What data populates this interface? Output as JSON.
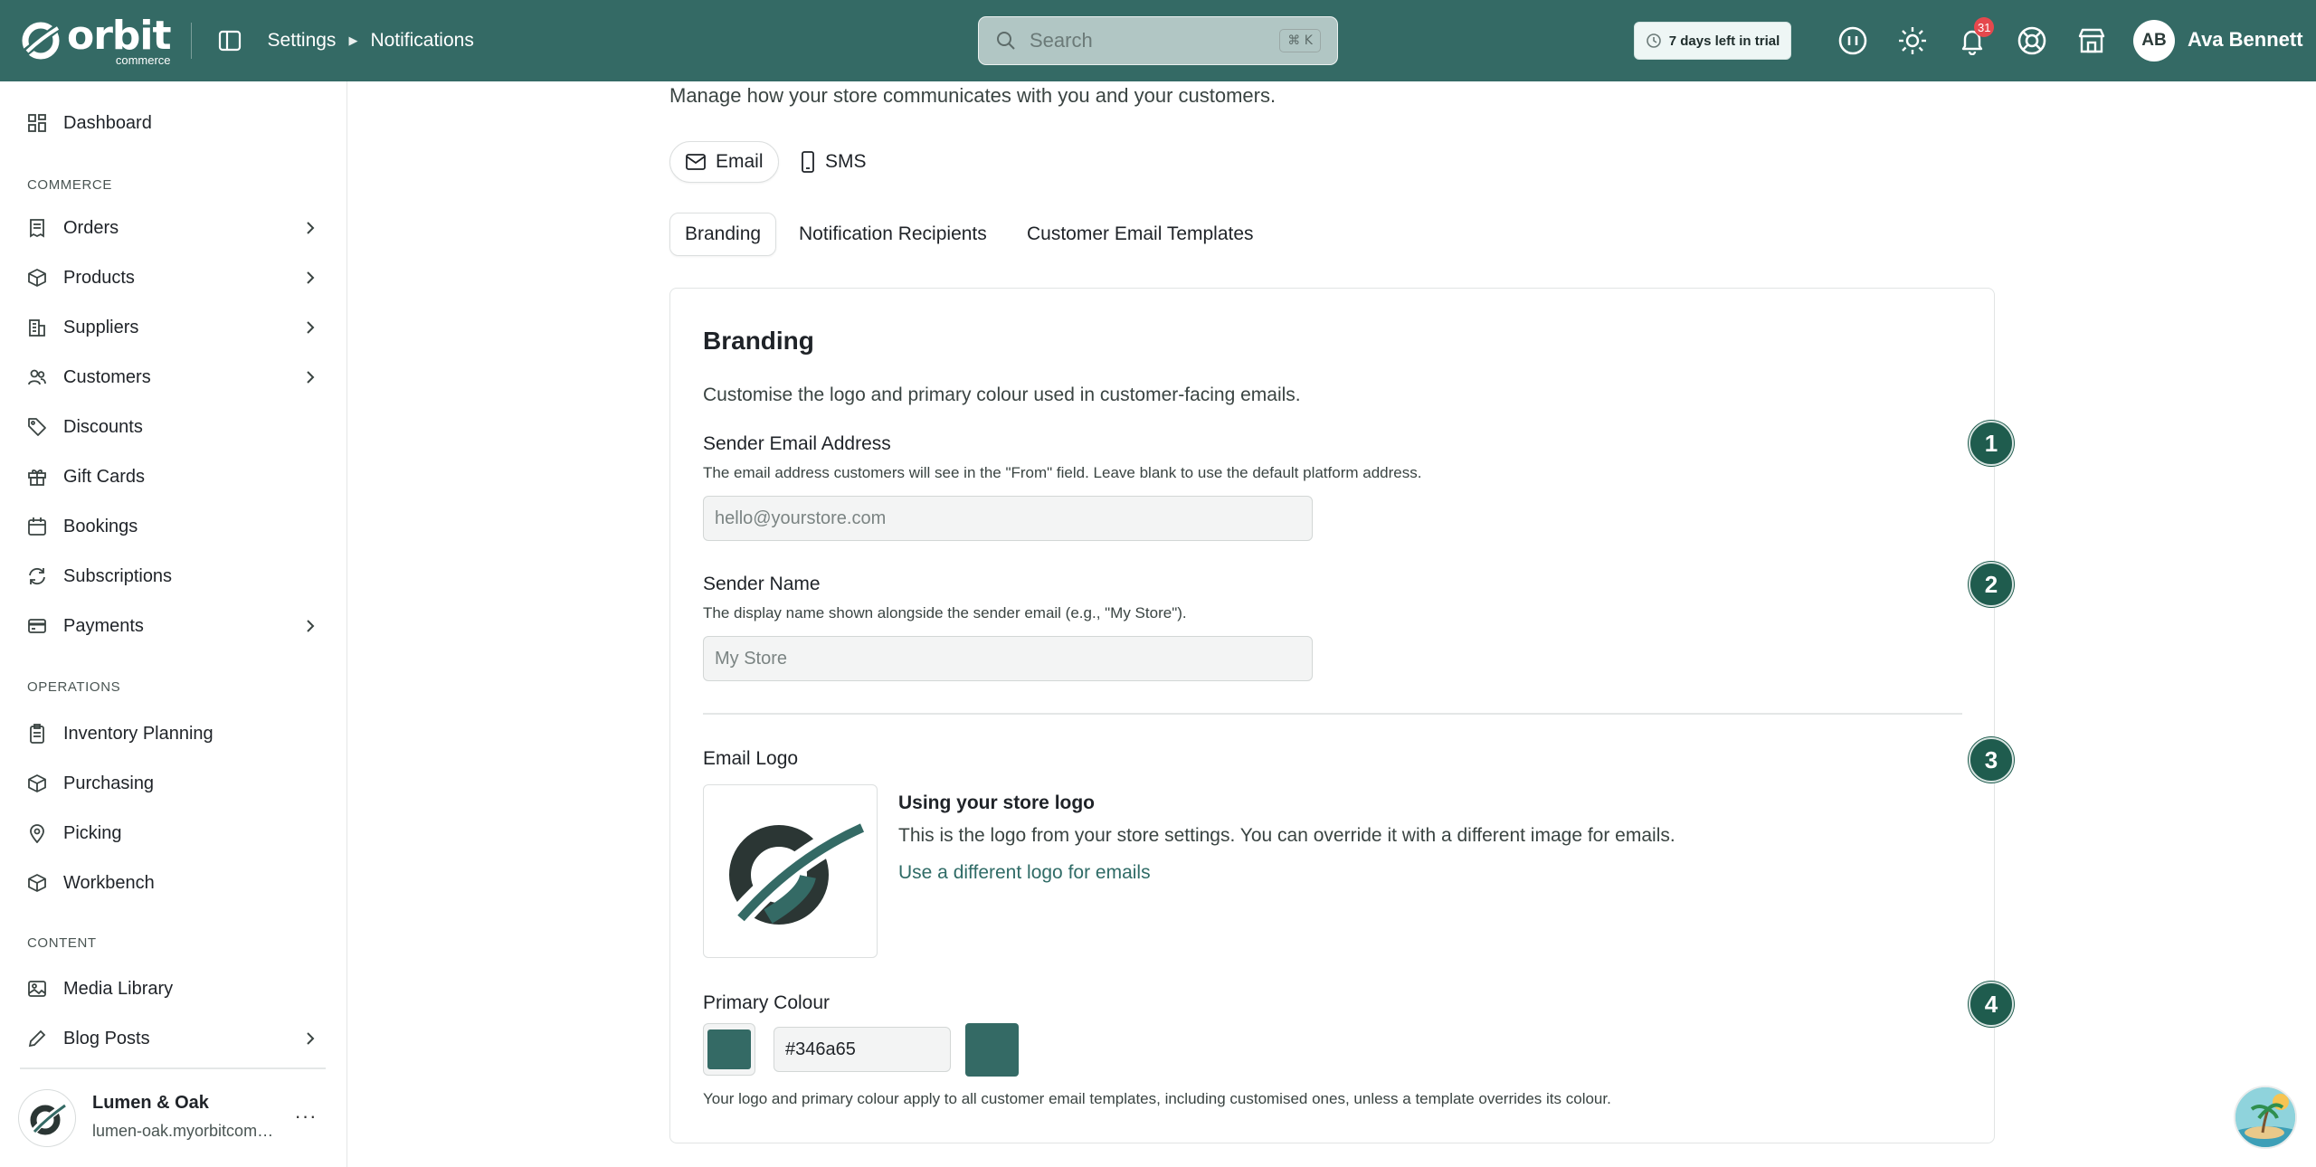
{
  "brand": {
    "name": "orbit",
    "sub": "commerce",
    "accent": "#346a65"
  },
  "breadcrumb": {
    "items": [
      "Settings",
      "Notifications"
    ]
  },
  "search": {
    "placeholder": "Search",
    "shortcut": "⌘ K"
  },
  "trial": {
    "label": "7 days left in trial"
  },
  "header_icons": [
    "help-bubble-icon",
    "sun-icon",
    "bell-icon",
    "lifebuoy-icon",
    "storefront-icon"
  ],
  "notifications": {
    "count": "31"
  },
  "user": {
    "initials": "AB",
    "name": "Ava Bennett"
  },
  "sidebar": {
    "top_item": "Dashboard",
    "sections": {
      "commerce": "COMMERCE",
      "operations": "OPERATIONS",
      "content": "CONTENT"
    },
    "commerce": [
      "Orders",
      "Products",
      "Suppliers",
      "Customers",
      "Discounts",
      "Gift Cards",
      "Bookings",
      "Subscriptions",
      "Payments"
    ],
    "operations": [
      "Inventory Planning",
      "Purchasing",
      "Picking",
      "Workbench"
    ],
    "content": [
      "Media Library",
      "Blog Posts"
    ]
  },
  "store": {
    "name": "Lumen & Oak",
    "url": "lumen-oak.myorbitcommerce.com",
    "menu": "···"
  },
  "page": {
    "subtitle": "Manage how your store communicates with you and your customers.",
    "channel_tabs": [
      "Email",
      "SMS"
    ],
    "active_channel": "Email",
    "sub_tabs": [
      "Branding",
      "Notification Recipients",
      "Customer Email Templates"
    ],
    "active_sub_tab": "Branding"
  },
  "branding": {
    "title": "Branding",
    "description": "Customise the logo and primary colour used in customer-facing emails.",
    "sender_email": {
      "label": "Sender Email Address",
      "help": "The email address customers will see in the \"From\" field. Leave blank to use the default platform address.",
      "placeholder": "hello@yourstore.com",
      "value": ""
    },
    "sender_name": {
      "label": "Sender Name",
      "help": "The display name shown alongside the sender email (e.g., \"My Store\").",
      "placeholder": "My Store",
      "value": ""
    },
    "email_logo": {
      "label": "Email Logo",
      "title": "Using your store logo",
      "description": "This is the logo from your store settings. You can override it with a different image for emails.",
      "link": "Use a different logo for emails"
    },
    "primary_colour": {
      "label": "Primary Colour",
      "value": "#346a65",
      "note": "Your logo and primary colour apply to all customer email templates, including customised ones, unless a template overrides its colour."
    }
  },
  "steps": [
    "1",
    "2",
    "3",
    "4"
  ]
}
